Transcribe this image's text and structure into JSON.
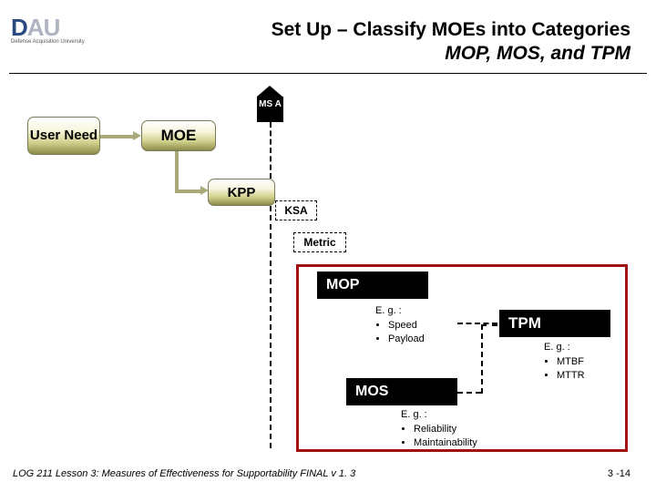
{
  "logo": {
    "text": "DAU",
    "subtext": "Defense Acquisition University"
  },
  "title": {
    "line1": "Set Up – Classify MOEs into Categories",
    "line2": "MOP, MOS, and TPM"
  },
  "milestone": "MS A",
  "boxes": {
    "user_need": "User Need",
    "moe": "MOE",
    "kpp": "KPP",
    "ksa": "KSA",
    "metric": "Metric",
    "mop": "MOP",
    "mos": "MOS",
    "tpm": "TPM"
  },
  "examples": {
    "mop": {
      "label": "E. g. :",
      "items": [
        "Speed",
        "Payload"
      ]
    },
    "mos": {
      "label": "E. g. :",
      "items": [
        "Reliability",
        "Maintainability"
      ]
    },
    "tpm": {
      "label": "E. g. :",
      "items": [
        "MTBF",
        "MTTR"
      ]
    }
  },
  "footer": {
    "left": "LOG 211 Lesson 3: Measures of Effectiveness for Supportability   FINAL v 1. 3",
    "right": "3 -14"
  }
}
